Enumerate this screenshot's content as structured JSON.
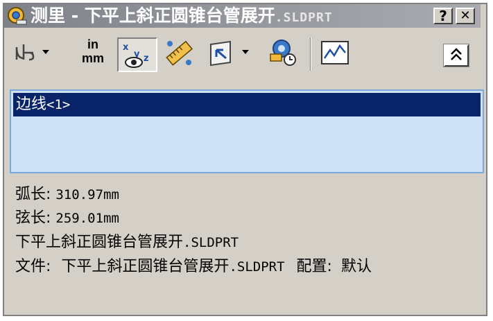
{
  "window": {
    "title_main": "测里 - 下平上斜正圆锥台管展开",
    "title_ext": ".SLDPRT",
    "help_label": "?",
    "close_label": "✕",
    "title_icon": "measure-tape-icon",
    "title_gradient": [
      "#7f8289",
      "#a9abb0"
    ]
  },
  "toolbar": {
    "tools": [
      {
        "name": "arc-circle-options-icon",
        "has_dropdown": true
      },
      {
        "name": "units-in-mm-icon",
        "label_top": "in",
        "label_bottom": "mm"
      },
      {
        "name": "show-xyz-measurements-icon",
        "pressed": true
      },
      {
        "name": "point-to-point-icon"
      },
      {
        "name": "projection-icon",
        "has_dropdown": true
      },
      {
        "name": "measure-history-icon"
      },
      {
        "name": "sensor-icon"
      }
    ],
    "collapse_icon": "collapse-up-icon",
    "collapse_glyph": "⌃"
  },
  "selection": {
    "items": [
      {
        "label": "边线",
        "suffix": "<1>"
      }
    ],
    "bg_color": "#cfe1f7",
    "selected_color": "#0a246a"
  },
  "results": {
    "arc_length_label": "弧长:",
    "arc_length_value": "310.97mm",
    "chord_length_label": "弦长:",
    "chord_length_value": "259.01mm",
    "part_name": "下平上斜正圆锥台管展开",
    "part_ext": ".SLDPRT",
    "file_label": "文件:",
    "file_name": "下平上斜正圆锥台管展开",
    "file_ext": ".SLDPRT",
    "config_label": "配置:",
    "config_value": "默认"
  }
}
